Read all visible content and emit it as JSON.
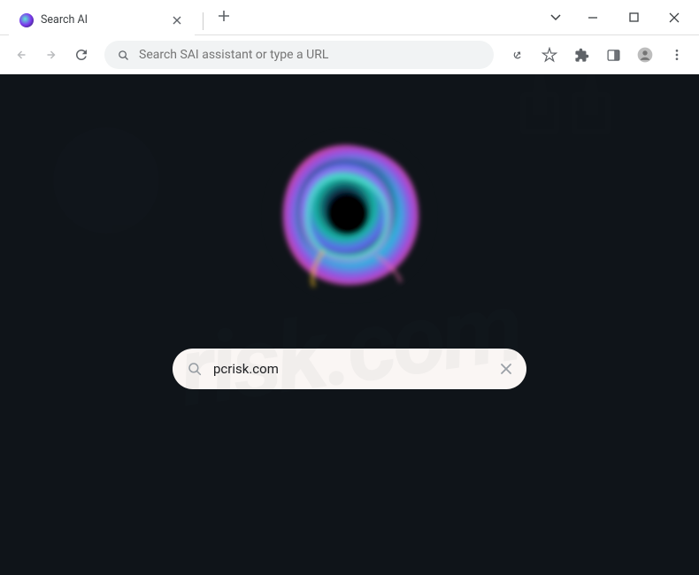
{
  "tab": {
    "title": "Search AI"
  },
  "omnibox": {
    "placeholder": "Search SAI assistant or type a URL",
    "value": ""
  },
  "search": {
    "value": "pcrisk.com",
    "placeholder": ""
  },
  "colors": {
    "page_bg": "#0f1419",
    "searchbar_bg": "#faf6f4"
  }
}
